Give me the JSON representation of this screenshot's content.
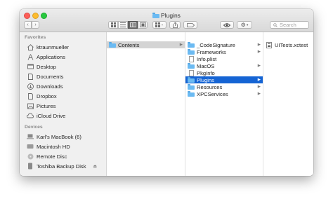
{
  "window": {
    "title": "Plugins"
  },
  "toolbar": {
    "back_icon": "chevron-left-icon",
    "forward_icon": "chevron-right-icon",
    "view_icons": [
      "icon-view-icon",
      "list-view-icon",
      "column-view-icon",
      "gallery-view-icon"
    ],
    "active_view": "column-view-icon",
    "search_placeholder": "Search"
  },
  "sidebar": {
    "favorites_heading": "Favorites",
    "favorites": [
      {
        "label": "ktraunmueller",
        "icon": "home-icon"
      },
      {
        "label": "Applications",
        "icon": "applications-icon"
      },
      {
        "label": "Desktop",
        "icon": "desktop-icon"
      },
      {
        "label": "Documents",
        "icon": "documents-icon"
      },
      {
        "label": "Downloads",
        "icon": "downloads-icon"
      },
      {
        "label": "Dropbox",
        "icon": "dropbox-icon"
      },
      {
        "label": "Pictures",
        "icon": "pictures-icon"
      },
      {
        "label": "iCloud Drive",
        "icon": "icloud-icon"
      }
    ],
    "devices_heading": "Devices",
    "devices": [
      {
        "label": "Karl's MacBook (6)",
        "icon": "laptop-icon"
      },
      {
        "label": "Macintosh HD",
        "icon": "hard-drive-icon"
      },
      {
        "label": "Remote Disc",
        "icon": "disc-icon"
      },
      {
        "label": "Toshiba Backup Disk",
        "icon": "external-drive-icon"
      }
    ]
  },
  "columns": {
    "col1": [
      {
        "label": "Contents",
        "type": "folder",
        "state": "selected-inactive"
      }
    ],
    "col2": [
      {
        "label": "_CodeSignature",
        "type": "folder",
        "state": ""
      },
      {
        "label": "Frameworks",
        "type": "folder",
        "state": ""
      },
      {
        "label": "Info.plist",
        "type": "file",
        "state": ""
      },
      {
        "label": "MacOS",
        "type": "folder",
        "state": ""
      },
      {
        "label": "PkgInfo",
        "type": "file",
        "state": ""
      },
      {
        "label": "Plugins",
        "type": "folder",
        "state": "selected-active"
      },
      {
        "label": "Resources",
        "type": "folder",
        "state": ""
      },
      {
        "label": "XPCServices",
        "type": "folder",
        "state": ""
      }
    ],
    "col3": [
      {
        "label": "UITests.xctest",
        "type": "bundle",
        "state": ""
      }
    ]
  },
  "colors": {
    "selection_active": "#1564d4",
    "selection_inactive": "#d4d4d4",
    "folder": "#6bbaf2"
  }
}
